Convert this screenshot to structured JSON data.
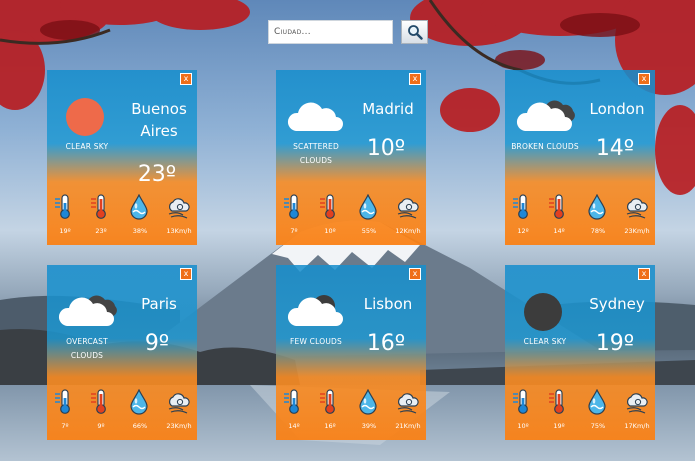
{
  "search": {
    "placeholder": "Ciudad..."
  },
  "close_label": "x",
  "cards": [
    {
      "city": "Buenos Aires",
      "condition": "Clear sky",
      "icon": "sun-icon",
      "temp": "23º",
      "min": "19º",
      "max": "23º",
      "humidity": "38%",
      "wind": "13Km/h"
    },
    {
      "city": "Madrid",
      "condition": "Scattered clouds",
      "icon": "cloud-icon",
      "temp": "10º",
      "min": "7º",
      "max": "10º",
      "humidity": "55%",
      "wind": "12Km/h"
    },
    {
      "city": "London",
      "condition": "Broken clouds",
      "icon": "broken-clouds-icon",
      "temp": "14º",
      "min": "12º",
      "max": "14º",
      "humidity": "78%",
      "wind": "23Km/h"
    },
    {
      "city": "Paris",
      "condition": "Overcast clouds",
      "icon": "overcast-clouds-icon",
      "temp": "9º",
      "min": "7º",
      "max": "9º",
      "humidity": "66%",
      "wind": "23Km/h"
    },
    {
      "city": "Lisbon",
      "condition": "Few clouds",
      "icon": "few-clouds-icon",
      "temp": "16º",
      "min": "14º",
      "max": "16º",
      "humidity": "39%",
      "wind": "21Km/h"
    },
    {
      "city": "Sydney",
      "condition": "Clear sky",
      "icon": "moon-icon",
      "temp": "19º",
      "min": "10º",
      "max": "19º",
      "humidity": "75%",
      "wind": "17Km/h"
    }
  ],
  "colors": {
    "card_top": "#168ecd",
    "card_bottom": "#fa8014",
    "sun": "#ee6a4a",
    "moon": "#3c3c3c",
    "close_button": "#ef6e19"
  }
}
